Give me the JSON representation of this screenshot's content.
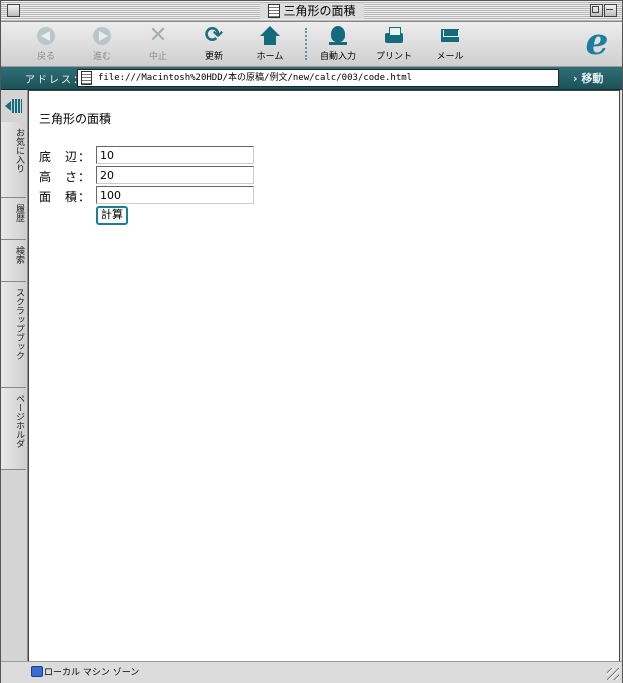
{
  "window": {
    "title": "三角形の面積"
  },
  "toolbar": {
    "buttons": [
      {
        "label": "戻る",
        "icon": "back-arrow-icon",
        "enabled": false
      },
      {
        "label": "進む",
        "icon": "forward-arrow-icon",
        "enabled": false
      },
      {
        "label": "中止",
        "icon": "stop-x-icon",
        "enabled": false
      },
      {
        "label": "更新",
        "icon": "refresh-icon",
        "enabled": true
      },
      {
        "label": "ホーム",
        "icon": "home-icon",
        "enabled": true
      },
      {
        "label": "自動入力",
        "icon": "autofill-icon",
        "enabled": true
      },
      {
        "label": "プリント",
        "icon": "print-icon",
        "enabled": true
      },
      {
        "label": "メール",
        "icon": "mail-icon",
        "enabled": true
      }
    ],
    "logo": "e"
  },
  "address": {
    "label": "アドレス：",
    "url": "file:///Macintosh%20HDD/本の原稿/例文/new/calc/003/code.html",
    "go_label": "› 移動"
  },
  "sidebar": {
    "tabs": [
      "お気に入り",
      "履歴",
      "検索",
      "スクラップブック",
      "ページホルダ"
    ]
  },
  "page": {
    "heading": "三角形の面積",
    "fields": [
      {
        "label": "底　辺：",
        "value": "10"
      },
      {
        "label": "高　さ：",
        "value": "20"
      },
      {
        "label": "面　積：",
        "value": "100"
      }
    ],
    "calc_button": "計算"
  },
  "status": {
    "text": "ローカル マシン ゾーン"
  },
  "colors": {
    "accent": "#136b7c",
    "address_bar": "#2f6f77",
    "focus_ring": "#1a7f93"
  }
}
